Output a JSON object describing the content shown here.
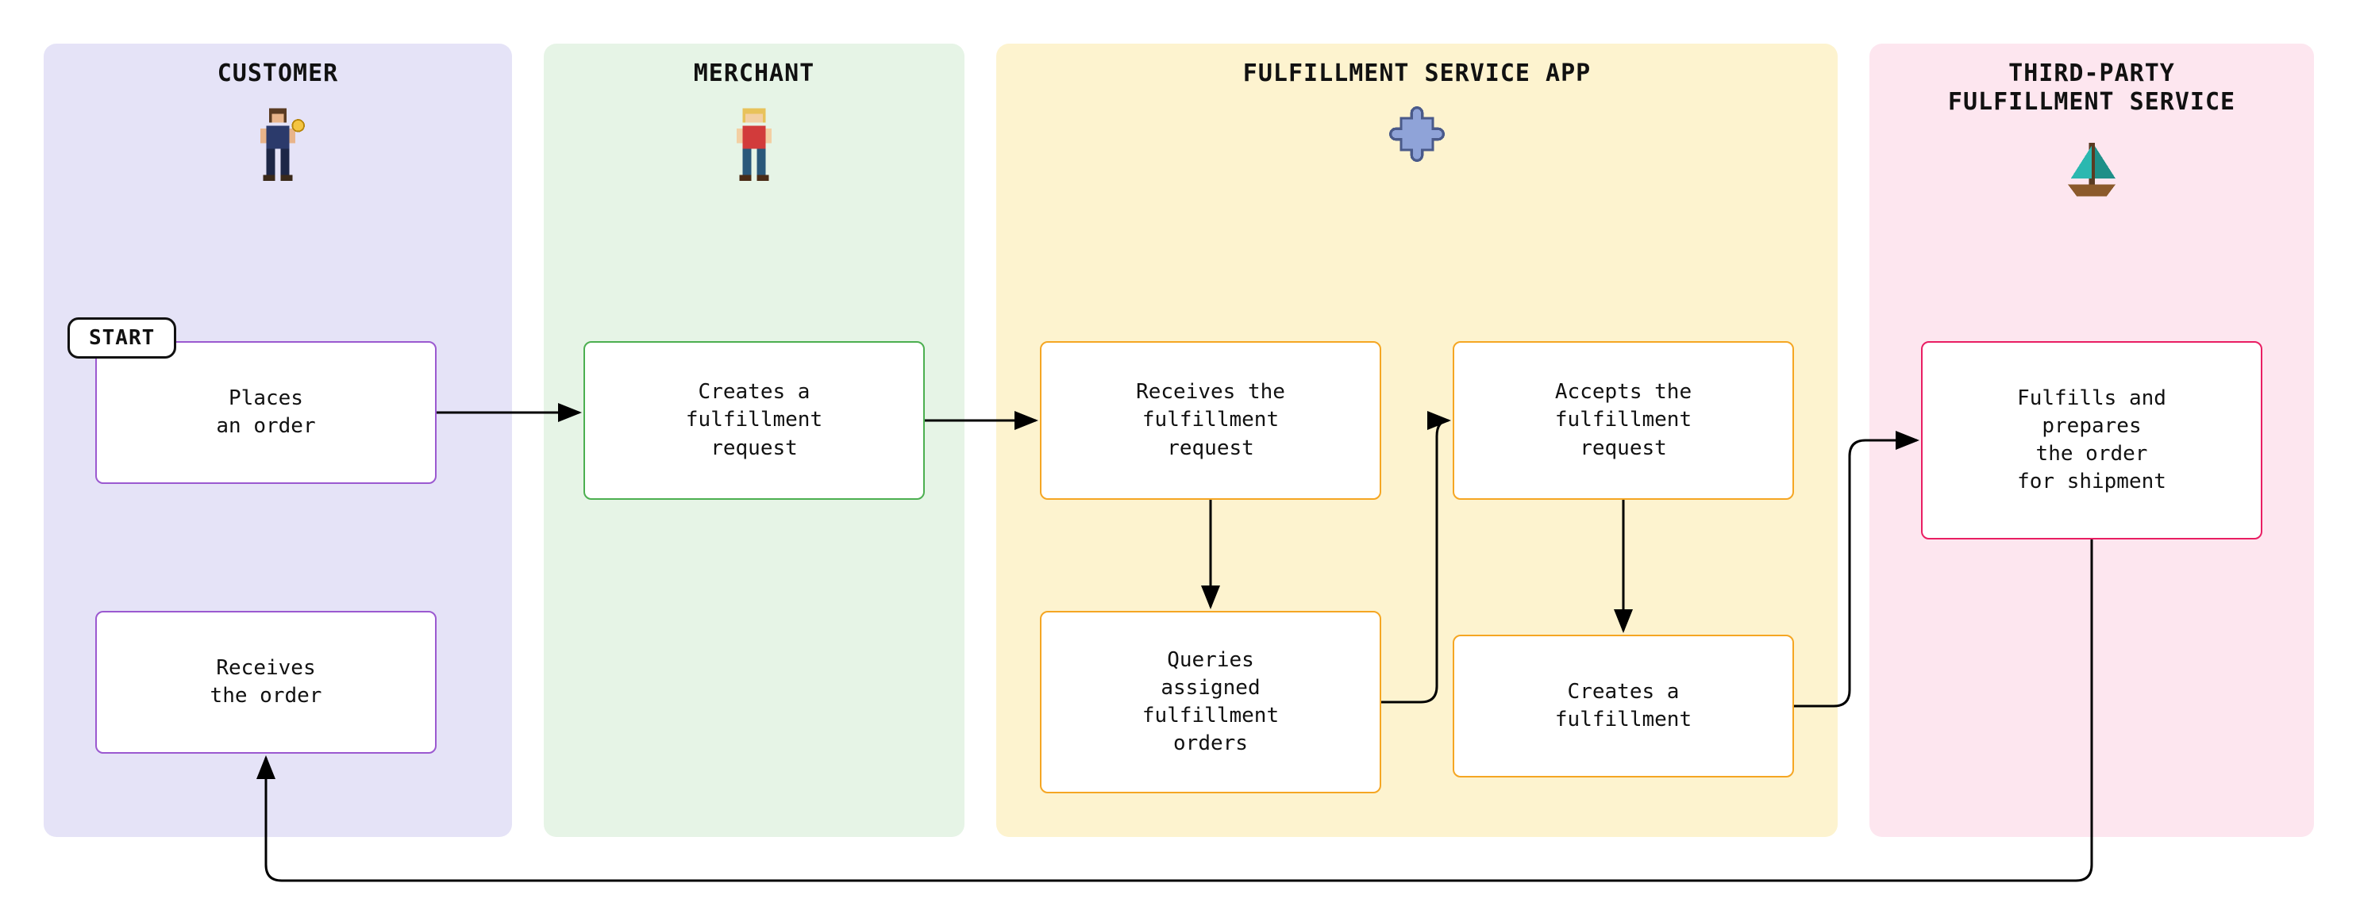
{
  "columns": {
    "customer": {
      "title": "CUSTOMER",
      "icon": "customer-icon"
    },
    "merchant": {
      "title": "MERCHANT",
      "icon": "merchant-icon"
    },
    "app": {
      "title": "FULFILLMENT SERVICE APP",
      "icon": "puzzle-icon"
    },
    "thirdparty": {
      "title": "THIRD-PARTY\nFULFILLMENT SERVICE",
      "icon": "boat-icon"
    }
  },
  "start_label": "START",
  "boxes": {
    "places_order": "Places\nan order",
    "receives_order": "Receives\nthe order",
    "creates_request": "Creates a\nfulfillment\nrequest",
    "receives_request": "Receives the\nfulfillment\nrequest",
    "queries_orders": "Queries\nassigned\nfulfillment\norders",
    "accepts_request": "Accepts the\nfulfillment\nrequest",
    "creates_fulfillment": "Creates a\nfulfillment",
    "fulfills_prepares": "Fulfills and\nprepares\nthe order\nfor shipment"
  },
  "flow_edges": [
    [
      "places_order",
      "creates_request"
    ],
    [
      "creates_request",
      "receives_request"
    ],
    [
      "receives_request",
      "queries_orders"
    ],
    [
      "queries_orders",
      "accepts_request"
    ],
    [
      "accepts_request",
      "creates_fulfillment"
    ],
    [
      "creates_fulfillment",
      "fulfills_prepares"
    ],
    [
      "fulfills_prepares",
      "receives_order"
    ]
  ]
}
